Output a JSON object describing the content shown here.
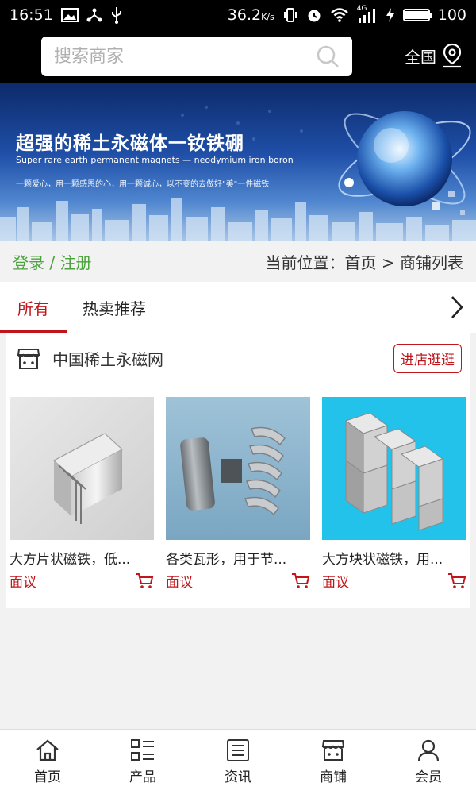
{
  "status_bar": {
    "time": "16:51",
    "speed": "36.2",
    "speed_unit": "K/s",
    "network": "4G",
    "battery": "100"
  },
  "search": {
    "placeholder": "搜索商家",
    "region_label": "全国"
  },
  "banner": {
    "title": "超强的稀土永磁体一钕铁硼",
    "subtitle": "Super rare earth permanent magnets — neodymium iron boron",
    "slogan": "一颗爱心，用一颗感恩的心，用一颗诚心，以不变的去做好\"美\"一件磁铁"
  },
  "breadcrumb": {
    "login": "登录 / 注册",
    "location": "当前位置：首页 > 商铺列表"
  },
  "tabs": [
    {
      "label": "所有",
      "active": true
    },
    {
      "label": "热卖推荐",
      "active": false
    }
  ],
  "shop": {
    "name": "中国稀土永磁网",
    "visit_label": "进店逛逛",
    "products": [
      {
        "name": "大方片状磁铁，低...",
        "price": "面议"
      },
      {
        "name": "各类瓦形，用于节...",
        "price": "面议"
      },
      {
        "name": "大方块状磁铁，用...",
        "price": "面议"
      }
    ]
  },
  "bottom_nav": [
    {
      "label": "首页",
      "icon": "home-icon"
    },
    {
      "label": "产品",
      "icon": "grid-list-icon"
    },
    {
      "label": "资讯",
      "icon": "news-icon"
    },
    {
      "label": "商铺",
      "icon": "shop-icon"
    },
    {
      "label": "会员",
      "icon": "user-icon"
    }
  ],
  "colors": {
    "accent": "#c0151a",
    "login_green": "#4aa33a",
    "status_bar": "#000000"
  }
}
